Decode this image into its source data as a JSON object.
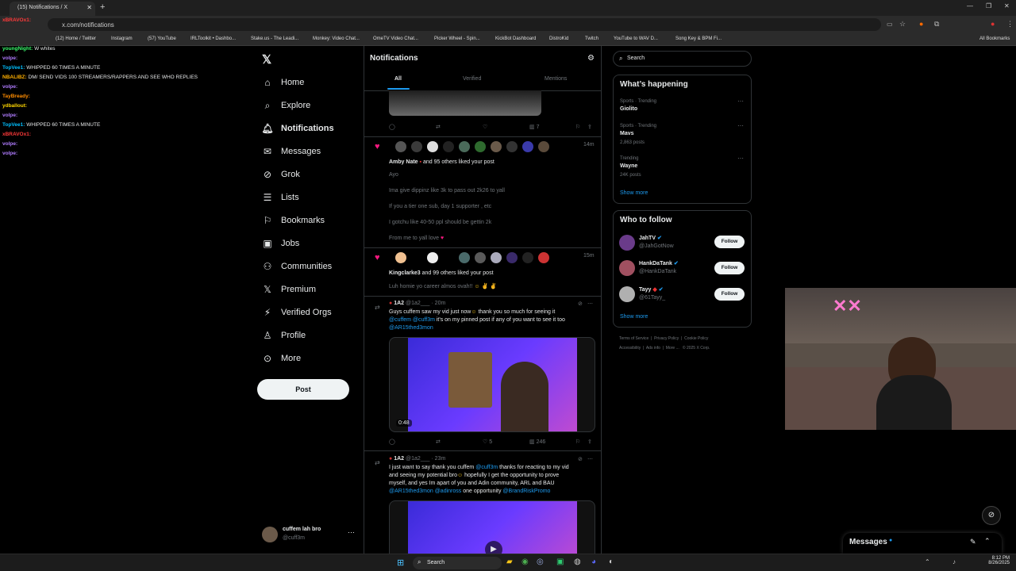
{
  "browser": {
    "tab_title": "(15) Notifications / X",
    "url": "x.com/notifications",
    "bookmarks": [
      "(12) Home / Twitter",
      "Instagram",
      "(57) YouTube",
      "IRLToolkit • Dashbo...",
      "Stake.us - The Leadi...",
      "Monkey: Video Chat...",
      "OmeTV Video Chat...",
      "Picker Wheel - Spin...",
      "KickBot Dashboard",
      "DistroKid",
      "Twitch",
      "YouTube to WAV D...",
      "Song Key & BPM Fi..."
    ],
    "all_bookmarks": "All Bookmarks"
  },
  "chat": [
    {
      "user": "xBRAVOx1:",
      "msg": "",
      "color": "#ff3a3a"
    },
    {
      "user": "youngNight:",
      "msg": "W whites",
      "color": "#3aff6e"
    },
    {
      "user": "volpe:",
      "msg": "",
      "color": "#9146ff"
    },
    {
      "user": "TopVee1:",
      "msg": "WHIPPED 60 TIMES A MINUTE",
      "color": "#00bfff"
    },
    {
      "user": "NBALIBZ:",
      "msg": "DM/ SEND VIDS 100 STREAMERS/RAPPERS AND SEE WHO REPLIES",
      "color": "#ffb000"
    },
    {
      "user": "volpe:",
      "msg": "",
      "color": "#9146ff"
    },
    {
      "user": "TayBready:",
      "msg": "",
      "color": "#ff8c00"
    },
    {
      "user": "ydballout:",
      "msg": "",
      "color": "#ffd700"
    },
    {
      "user": "volpe:",
      "msg": "",
      "color": "#9146ff"
    },
    {
      "user": "TopVee1:",
      "msg": "WHIPPED 60 TIMES A MINUTE",
      "color": "#00bfff"
    },
    {
      "user": "xBRAVOx1:",
      "msg": "",
      "color": "#ff3a3a"
    },
    {
      "user": "volpe:",
      "msg": "",
      "color": "#9146ff"
    },
    {
      "user": "volpe:",
      "msg": "",
      "color": "#9146ff"
    }
  ],
  "nav": {
    "items": [
      "Home",
      "Explore",
      "Notifications",
      "Messages",
      "Grok",
      "Lists",
      "Bookmarks",
      "Jobs",
      "Communities",
      "Premium",
      "Verified Orgs",
      "Profile",
      "More"
    ],
    "post_label": "Post",
    "account_name": "cuffem lah bro",
    "account_handle": "@cuff3m"
  },
  "notifications": {
    "title": "Notifications",
    "tabs": [
      "All",
      "Verified",
      "Mentions"
    ],
    "top_views": "7",
    "like1": {
      "time": "14m",
      "actor": "Amby Nate",
      "rest": " and 95 others liked your post",
      "lines": [
        "Ayo",
        "Ima give dippinz like 3k to pass out 2k26 to yall",
        "If you a tier one sub, day 1 supporter , etc",
        "I gotchu like 40-50 ppl should be gettin 2k",
        "From me to yall love"
      ]
    },
    "like2": {
      "time": "15m",
      "actor": "Kingclarke3",
      "rest": " and 99 others liked your post",
      "line": "Luh homie yo career almos ovah!!"
    },
    "post1": {
      "name": "1A2",
      "handle": "@1a2___ · 20m",
      "text_a": "Guys cuffem saw my vid just now",
      "text_b": " thank you so much for seeing it",
      "mention1": "@cuffem @cuff3m",
      "text_c": " it's on my pinned post if any of you want to see it too",
      "mention2": "@AR15thed3mon",
      "duration": "0:48",
      "likes": "5",
      "views": "246"
    },
    "post2": {
      "name": "1A2",
      "handle": "@1a2___ · 23m",
      "l1a": "I just want to say thank you cuffem ",
      "l1b": "@cuff3m",
      "l1c": " thanks for reacting to my vid",
      "l2": "and seeing my potential bro",
      "l2b": " hopefully I get the opportunity to prove",
      "l3": "myself, and yes Im apart of you and Adin community, ARL and BAU",
      "l4a": "@AR15thed3mon @adinross",
      "l4b": " one opportunity ",
      "l4c": "@BrandRiskPromo"
    }
  },
  "sidebar": {
    "search_placeholder": "Search",
    "happening_title": "What’s happening",
    "trends": [
      {
        "meta": "Sports · Trending",
        "name": "Giolito",
        "posts": ""
      },
      {
        "meta": "Sports · Trending",
        "name": "Mavs",
        "posts": "2,863 posts"
      },
      {
        "meta": "Trending",
        "name": "Wayne",
        "posts": "24K posts"
      }
    ],
    "show_more": "Show more",
    "follow_title": "Who to follow",
    "follow": [
      {
        "name": "JahTV",
        "handle": "@JahGotNow",
        "color": "#6a3b8a"
      },
      {
        "name": "HankDaTank",
        "handle": "@HankDaTank",
        "color": "#a05060"
      },
      {
        "name": "Tayy",
        "handle": "@61Tayy_",
        "color": "#b0b0b0"
      }
    ],
    "follow_label": "Follow",
    "footer1": [
      "Terms of Service",
      "Privacy Policy",
      "Cookie Policy"
    ],
    "footer2": [
      "Accessibility",
      "Ads info",
      "More ...",
      "© 2025 X Corp."
    ]
  },
  "messages_drawer": "Messages",
  "taskbar": {
    "search": "Search",
    "time": "8:12 PM",
    "date": "8/26/2025"
  },
  "colors": {
    "accent": "#1d9bf0",
    "like": "#f91880",
    "border": "#2f3336"
  }
}
